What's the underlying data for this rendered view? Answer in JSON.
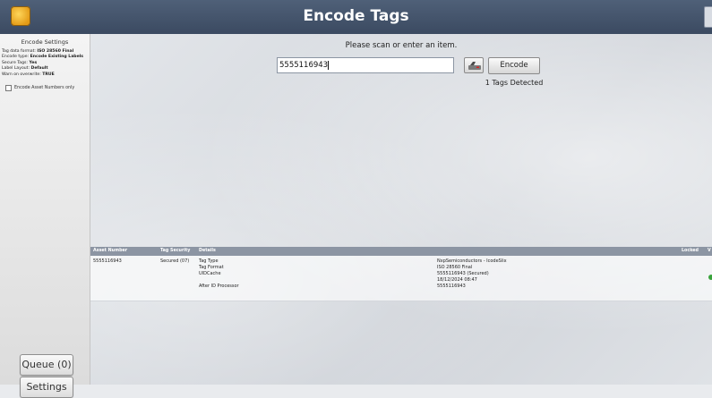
{
  "window": {
    "title": "Encode Tags"
  },
  "sidebar": {
    "title": "Encode Settings",
    "settings": [
      {
        "label": "Tag data format:",
        "value": "ISO 28560 Final"
      },
      {
        "label": "Encode type:",
        "value": "Encode Existing Labels"
      },
      {
        "label": "Secure Tags:",
        "value": "Yes"
      },
      {
        "label": "Label Layout:",
        "value": "Default"
      },
      {
        "label": "Warn on overwrite:",
        "value": "TRUE"
      }
    ],
    "asset_only_label": "Encode Asset Numbers only",
    "asset_only_checked": false,
    "queue_label": "Queue (0)",
    "settings_label": "Settings"
  },
  "scan": {
    "prompt": "Please scan or enter an item.",
    "value": "5555116943",
    "encode_label": "Encode",
    "detected": "1 Tags Detected"
  },
  "grid": {
    "headers": [
      "Asset Number",
      "Tag Security",
      "Details",
      "Locked",
      "V"
    ],
    "rows": [
      {
        "asset": "5555116943",
        "security": "Secured (07)",
        "details": [
          {
            "name": "Tag Type",
            "value": "NxpSemiconductors - IcodeSlix"
          },
          {
            "name": "Tag Format",
            "value": "ISO 28560 Final"
          },
          {
            "name": "UIDCache",
            "value": "5555116943 (Secured)"
          },
          {
            "name": "",
            "value": "18/12/2024 08:47"
          },
          {
            "name": "After ID Processor",
            "value": "5555116943"
          }
        ],
        "status_color": "#39a33c"
      }
    ]
  },
  "colors": {
    "titlebar": "#3b4a61",
    "grid_header": "#8c95a3",
    "accent_icon": "#e39b17"
  },
  "icons": [
    "app-icon",
    "scanner-icon",
    "status-icon"
  ]
}
